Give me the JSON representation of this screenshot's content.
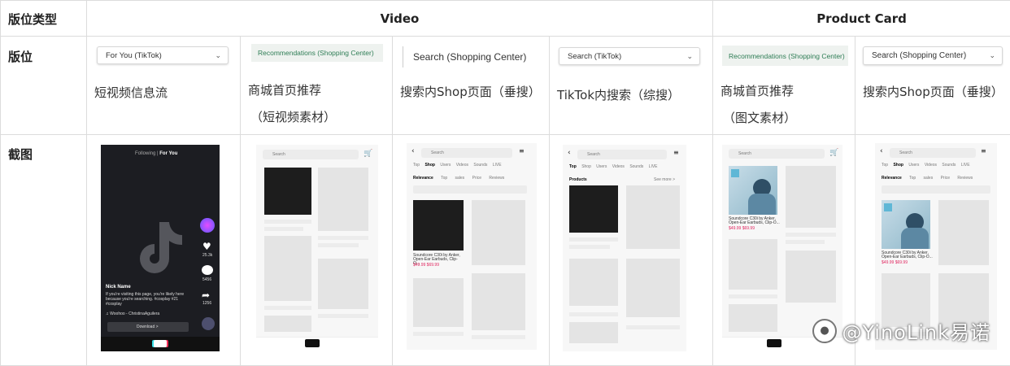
{
  "header": {
    "col_label": "版位类型",
    "video": "Video",
    "product_card": "Product Card"
  },
  "rows": {
    "placement": "版位",
    "screenshot": "截图"
  },
  "placements": [
    {
      "tag": "For You (TikTok)",
      "desc1": "短视频信息流",
      "desc2": ""
    },
    {
      "tag": "Recommendations (Shopping Center)",
      "desc1": "商城首页推荐",
      "desc2": "（短视频素材）"
    },
    {
      "tag": "Search (Shopping Center)",
      "desc1": "搜索内Shop页面（垂搜）",
      "desc2": ""
    },
    {
      "tag": "Search (TikTok)",
      "desc1": "TikTok内搜索（综搜）",
      "desc2": ""
    },
    {
      "tag": "Recommendations (Shopping Center)",
      "desc1": "商城首页推荐",
      "desc2": "（图文素材）"
    },
    {
      "tag": "Search (Shopping Center)",
      "desc1": "搜索内Shop页面（垂搜）",
      "desc2": ""
    }
  ],
  "screens": {
    "foryou": {
      "tab_following": "Following",
      "tab_foryou": "For You",
      "name": "Nick Name",
      "caption": "If you're visiting this page, you're likely here because you're searching. #cosplay #21 #cosplay",
      "music": "♫ Woohoo - ChristinaAguilera",
      "likes": "25.3k",
      "comments": "5456",
      "shares": "1256",
      "download": "Download >"
    },
    "search_tabs": [
      "Top",
      "Shop",
      "Users",
      "Videos",
      "Sounds",
      "LIVE"
    ],
    "shop_filters": [
      "Relevance",
      "Top sales",
      "Price",
      "Reviews"
    ],
    "tiktok_tabs": [
      "Top",
      "Shop",
      "Users",
      "Videos",
      "Sounds",
      "LIVE"
    ],
    "products_label": "Products",
    "see_more": "See more >",
    "product_title": "Soundcore C30i by Anker, Open-Ear Earbuds, Clip-O...",
    "product_price": "$49.99  $69.99",
    "search_placeholder": "Search"
  },
  "watermark": "@YinoLink易诺"
}
